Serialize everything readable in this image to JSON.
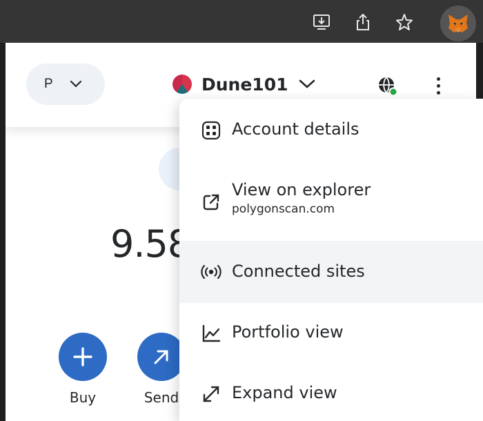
{
  "browser": {
    "icons": [
      "install-app-icon",
      "share-icon",
      "bookmark-star-icon",
      "metamask-fox-icon"
    ]
  },
  "header": {
    "network_letter": "P",
    "account_name": "Dune101",
    "connection_status_color": "#28a745"
  },
  "wallet": {
    "balance": "9.58",
    "actions": [
      {
        "label": "Buy",
        "icon": "plus-icon"
      },
      {
        "label": "Send",
        "icon": "arrow-up-right-icon"
      }
    ],
    "accent_color": "#2d6bc4"
  },
  "menu": {
    "items": [
      {
        "label": "Account details",
        "icon": "qr-code-icon"
      },
      {
        "label": "View on explorer",
        "sublabel": "polygonscan.com",
        "icon": "external-link-icon"
      },
      {
        "label": "Connected sites",
        "icon": "broadcast-icon",
        "highlighted": true
      },
      {
        "label": "Portfolio view",
        "icon": "line-chart-icon"
      },
      {
        "label": "Expand view",
        "icon": "expand-arrows-icon"
      }
    ]
  }
}
